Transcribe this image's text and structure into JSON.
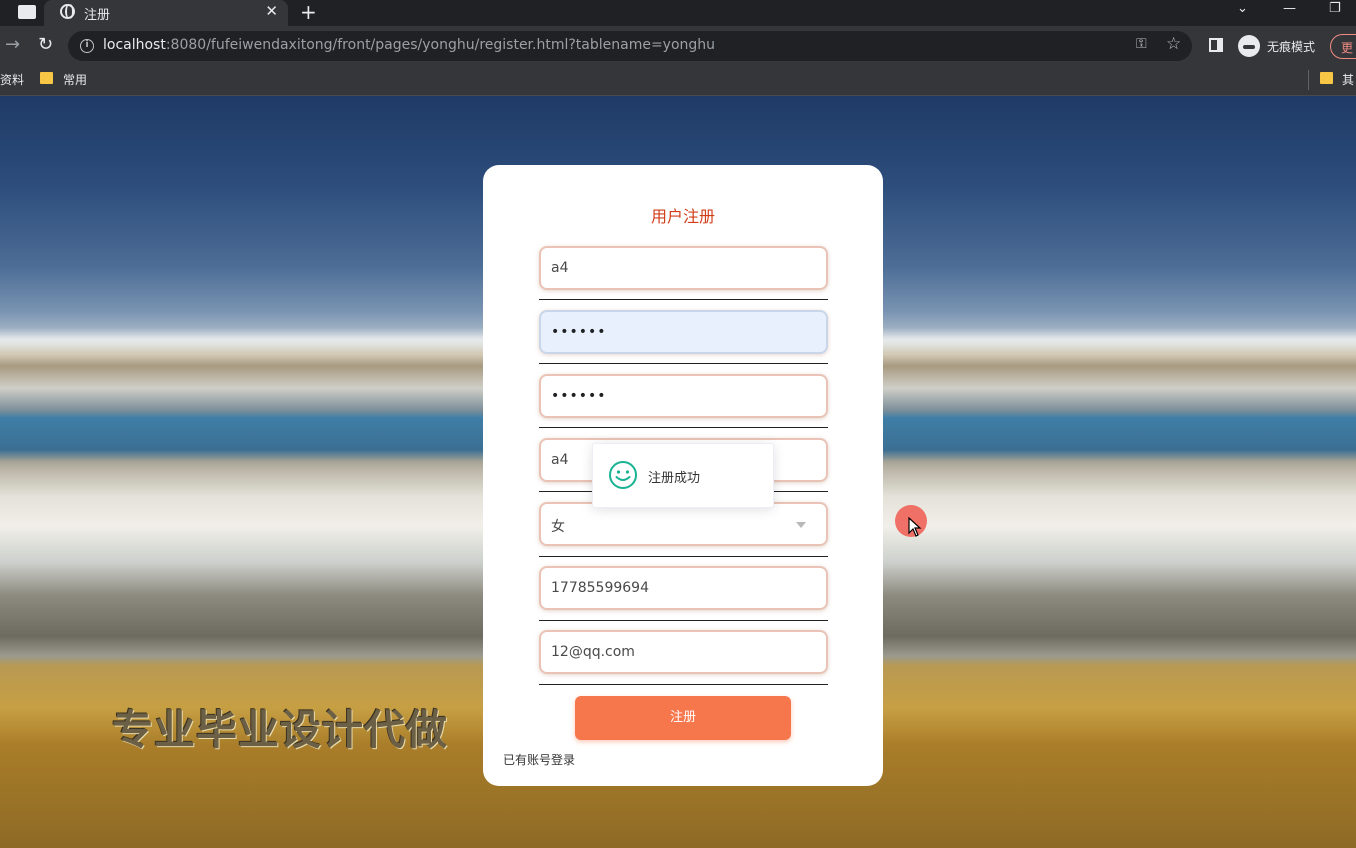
{
  "browser": {
    "tab_title": "注册",
    "url_host": "localhost",
    "url_rest": ":8080/fufeiwendaxitong/front/pages/yonghu/register.html?tablename=yonghu",
    "incognito_label": "无痕模式",
    "update_label": "更",
    "bookmarks": {
      "left": "资料",
      "common": "常用",
      "right": "其"
    }
  },
  "page": {
    "watermark": "专业毕业设计代做",
    "form": {
      "title": "用户注册",
      "fields": {
        "account": "a4",
        "password": "••••••",
        "confirm_password": "••••••",
        "name": "a4",
        "gender": "女",
        "phone": "17785599694",
        "email": "12@qq.com"
      },
      "submit_label": "注册",
      "login_link": "已有账号登录"
    },
    "toast": {
      "message": "注册成功",
      "icon": "smile-icon",
      "color": "#1ab394"
    }
  },
  "colors": {
    "title": "#d23e1a",
    "button": "#f7774d",
    "chrome_bg": "#202124",
    "toolbar_bg": "#35363a"
  }
}
